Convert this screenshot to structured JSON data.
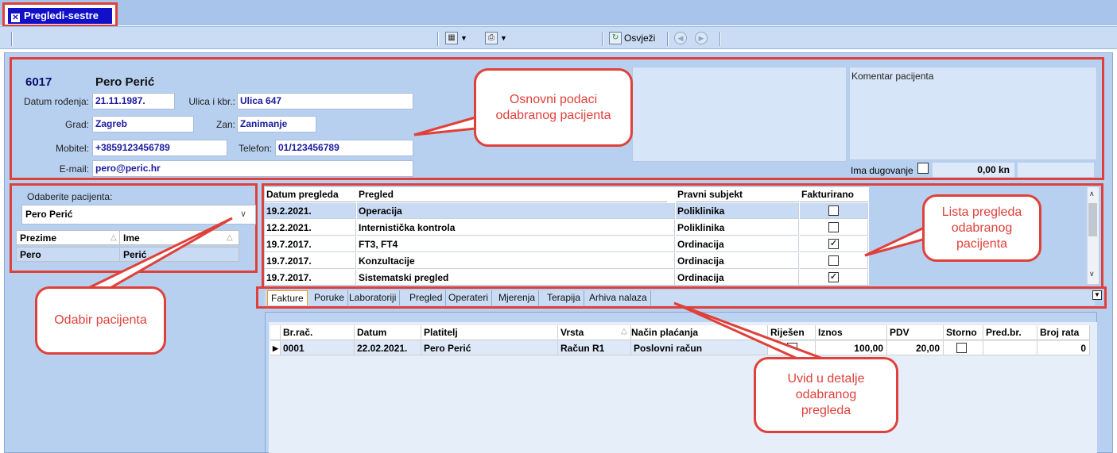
{
  "window": {
    "title": "Pregledi-sestre",
    "close_glyph": "✕"
  },
  "toolbar": {
    "refresh_label": "Osvježi"
  },
  "patient": {
    "id": "6017",
    "name": "Pero Perić",
    "dob_label": "Datum rođenja:",
    "dob": "21.11.1987.",
    "street_label": "Ulica i kbr.:",
    "street": "Ulica 647",
    "city_label": "Grad:",
    "city": "Zagreb",
    "job_label": "Zan:",
    "job": "Zanimanje",
    "mobile_label": "Mobitel:",
    "mobile": "+3859123456789",
    "phone_label": "Telefon:",
    "phone": "01/123456789",
    "email_label": "E-mail:",
    "email": "pero@peric.hr",
    "comment_label": "Komentar pacijenta",
    "debt_label": "Ima dugovanje",
    "debt_amount": "0,00 kn"
  },
  "selector": {
    "label": "Odaberite pacijenta:",
    "selected": "Pero Perić",
    "columns": [
      "Prezime",
      "Ime"
    ],
    "rows": [
      {
        "prezime": "Pero",
        "ime": "Perić"
      }
    ]
  },
  "exams": {
    "columns": [
      "Datum pregleda",
      "Pregled",
      "Pravni subjekt",
      "Fakturirano"
    ],
    "rows": [
      {
        "date": "19.2.2021.",
        "exam": "Operacija",
        "entity": "Poliklinika",
        "invoiced": false
      },
      {
        "date": "12.2.2021.",
        "exam": "Internistička kontrola",
        "entity": "Poliklinika",
        "invoiced": false
      },
      {
        "date": "19.7.2017.",
        "exam": "FT3, FT4",
        "entity": "Ordinacija",
        "invoiced": true
      },
      {
        "date": "19.7.2017.",
        "exam": "Konzultacije",
        "entity": "Ordinacija",
        "invoiced": false
      },
      {
        "date": "19.7.2017.",
        "exam": "Sistematski pregled",
        "entity": "Ordinacija",
        "invoiced": true
      }
    ]
  },
  "tabs": [
    "Fakture",
    "Poruke",
    "Laboratoriji",
    "Pregled",
    "Operateri",
    "Mjerenja",
    "Terapija",
    "Arhiva nalaza"
  ],
  "invoices": {
    "columns": [
      "Br.rač.",
      "Datum",
      "Platitelj",
      "Vrsta",
      "Način plaćanja",
      "Riješen",
      "Iznos",
      "PDV",
      "Storno",
      "Pred.br.",
      "Broj rata"
    ],
    "rows": [
      {
        "no": "0001",
        "date": "22.02.2021.",
        "payer": "Pero Perić",
        "type": "Račun R1",
        "payment": "Poslovni račun",
        "amount": "100,00",
        "vat": "20,00",
        "installments": "0"
      }
    ]
  },
  "callouts": {
    "info": "Osnovni podaci odabranog pacijenta",
    "list": "Lista pregleda odabranog pacijenta",
    "select": "Odabir pacijenta",
    "details": "Uvid u detalje odabranog pregleda"
  },
  "colors": {
    "accent_red": "#e0403a",
    "title_blue": "#1010c8",
    "panel_blue": "#b8d0f0"
  }
}
